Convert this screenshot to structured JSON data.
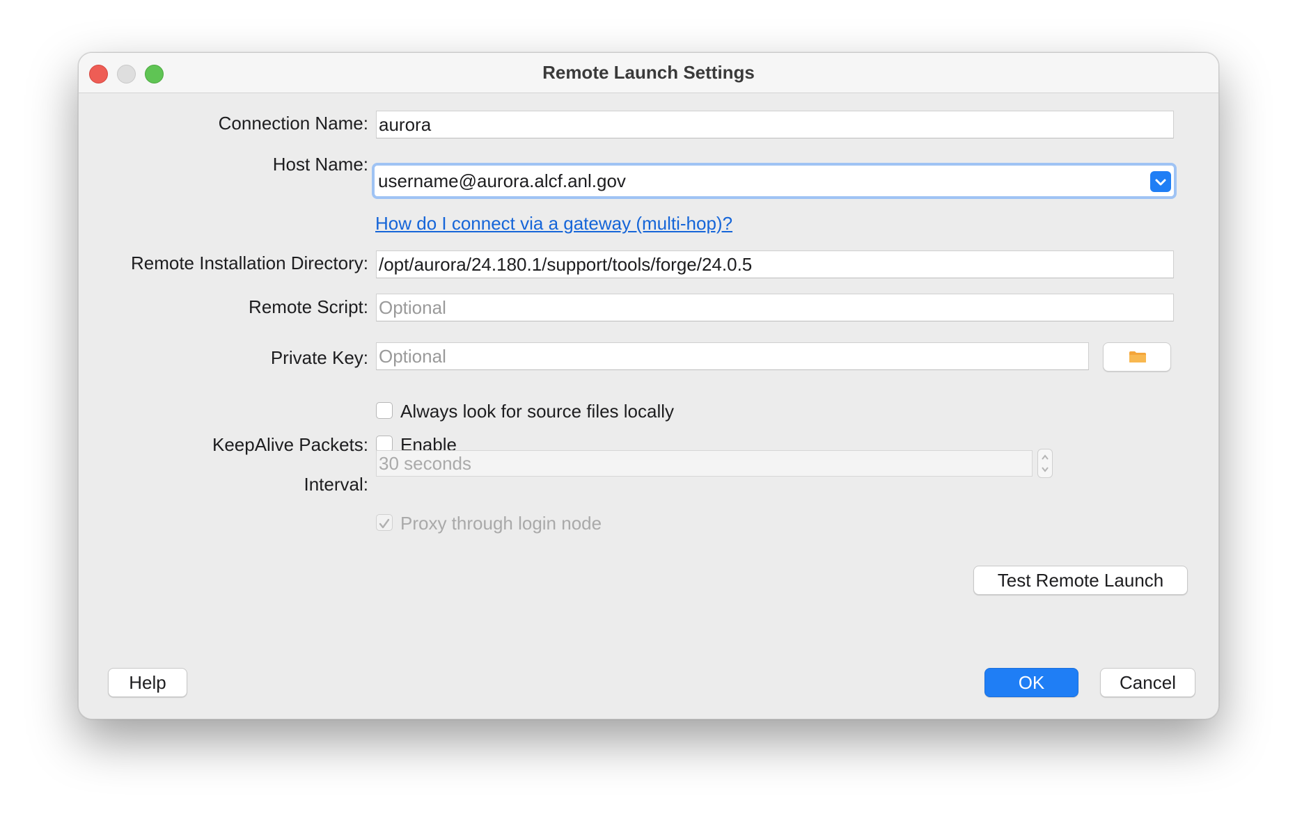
{
  "window": {
    "title": "Remote Launch Settings"
  },
  "form": {
    "connection_name": {
      "label": "Connection Name:",
      "value": "aurora"
    },
    "host_name": {
      "label": "Host Name:",
      "value": "username@aurora.alcf.anl.gov"
    },
    "gateway_link": "How do I connect via a gateway (multi-hop)?",
    "install_dir": {
      "label": "Remote Installation Directory:",
      "value": "/opt/aurora/24.180.1/support/tools/forge/24.0.5"
    },
    "remote_script": {
      "label": "Remote Script:",
      "placeholder": "Optional",
      "value": ""
    },
    "private_key": {
      "label": "Private Key:",
      "placeholder": "Optional",
      "value": ""
    },
    "look_local": {
      "label": "Always look for source files locally",
      "checked": false
    },
    "keepalive": {
      "label": "KeepAlive Packets:",
      "checkbox_label": "Enable",
      "checked": false
    },
    "interval": {
      "label": "Interval:",
      "value": "30 seconds",
      "disabled": true
    },
    "proxy": {
      "label": "Proxy through login node",
      "checked": true,
      "disabled": true
    }
  },
  "buttons": {
    "test": "Test Remote Launch",
    "help": "Help",
    "ok": "OK",
    "cancel": "Cancel"
  },
  "icons": {
    "host_dropdown": "chevron-down-icon",
    "browse": "folder-icon"
  },
  "colors": {
    "accent": "#1f7ef5",
    "link": "#1565d8",
    "focus_ring": "#9fc3f4",
    "close": "#ee5d55",
    "minimize": "#dedede",
    "maximize": "#5fc454"
  }
}
